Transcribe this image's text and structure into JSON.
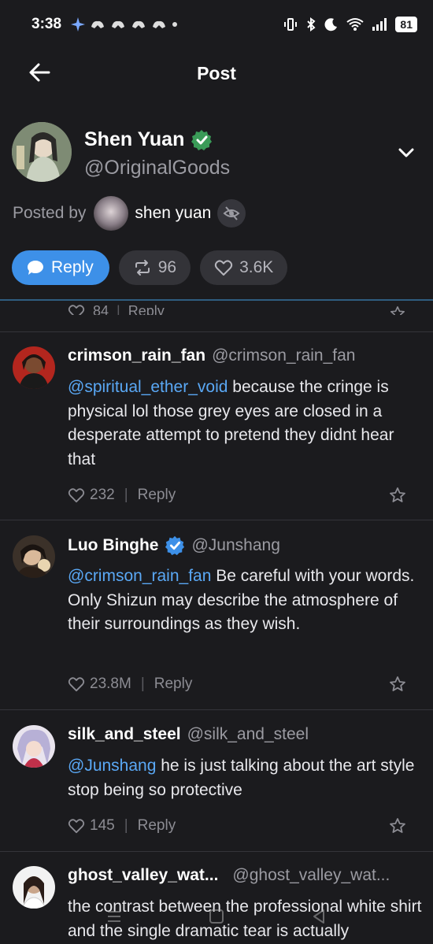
{
  "status": {
    "time": "3:38",
    "battery": "81"
  },
  "header": {
    "title": "Post"
  },
  "author": {
    "name": "Shen Yuan",
    "handle": "@OriginalGoods",
    "posted_by_label": "Posted by",
    "posted_by_user": "shen yuan"
  },
  "actions": {
    "reply_label": "Reply",
    "reposts": "96",
    "likes": "3.6K"
  },
  "previous_comment": {
    "likes": "84",
    "reply_label": "Reply"
  },
  "comments": [
    {
      "name": "crimson_rain_fan",
      "handle": "@crimson_rain_fan",
      "mention": "@spiritual_ether_void",
      "text": " because the cringe is physical lol those grey eyes are closed in a desperate attempt to pretend they didnt hear that",
      "likes": "232",
      "reply_label": "Reply",
      "verified": false
    },
    {
      "name": "Luo Binghe",
      "handle": "@Junshang",
      "mention": "@crimson_rain_fan",
      "text": " Be careful with your words. Only Shizun may describe the atmosphere of their surroundings as they wish.",
      "likes": "23.8M",
      "reply_label": "Reply",
      "verified": true
    },
    {
      "name": "silk_and_steel",
      "handle": "@silk_and_steel",
      "mention": "@Junshang",
      "text": " he is just talking about the art style stop being so protective",
      "likes": "145",
      "reply_label": "Reply",
      "verified": false
    },
    {
      "name": "ghost_valley_wat...",
      "handle": "@ghost_valley_wat...",
      "mention": "",
      "text": "the contrast between the professional white shirt and the single dramatic tear is actually",
      "likes": "",
      "reply_label": "",
      "verified": false
    }
  ],
  "colors": {
    "background": "#1b1b1e",
    "accent": "#3d90e8",
    "mention": "#5aa8f5",
    "verified": "#3a9b58"
  }
}
